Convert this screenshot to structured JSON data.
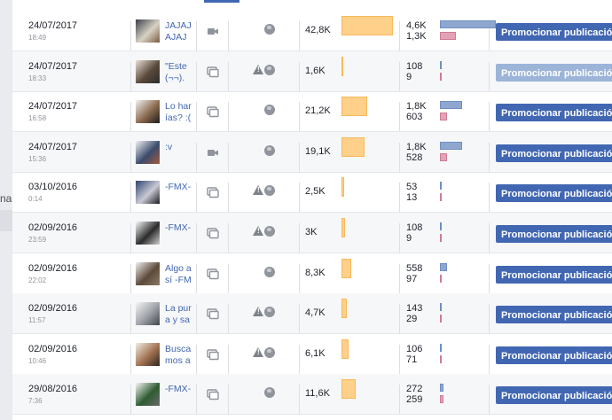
{
  "sidebar": {
    "text": "na"
  },
  "promo_label": "Promocionar publicación",
  "rows": [
    {
      "date": "24/07/2017",
      "time": "18:49",
      "title": "JAJAJAJAJ",
      "type": "video",
      "warn": false,
      "reach": "42,8K",
      "reach_frac": 1.0,
      "eng1": "4,6K",
      "eng2": "1,3K",
      "eng1_frac": 1.0,
      "eng2_frac": 0.28,
      "promo_disabled": false
    },
    {
      "date": "24/07/2017",
      "time": "18:33",
      "title": "\"Este (¬¬).",
      "type": "share",
      "warn": true,
      "reach": "1,6K",
      "reach_frac": 0.03,
      "eng1": "108",
      "eng2": "9",
      "eng1_frac": 0.02,
      "eng2_frac": 0.01,
      "promo_disabled": true
    },
    {
      "date": "24/07/2017",
      "time": "16:58",
      "title": "Lo harías? :(",
      "type": "share",
      "warn": false,
      "reach": "21,2K",
      "reach_frac": 0.5,
      "eng1": "1,8K",
      "eng2": "603",
      "eng1_frac": 0.39,
      "eng2_frac": 0.13,
      "promo_disabled": false
    },
    {
      "date": "24/07/2017",
      "time": "15:36",
      "title": ":v",
      "type": "video",
      "warn": false,
      "reach": "19,1K",
      "reach_frac": 0.45,
      "eng1": "1,8K",
      "eng2": "528",
      "eng1_frac": 0.39,
      "eng2_frac": 0.12,
      "promo_disabled": false
    },
    {
      "date": "03/10/2016",
      "time": "0:14",
      "title": "-FMX-",
      "type": "share",
      "warn": true,
      "reach": "2,5K",
      "reach_frac": 0.06,
      "eng1": "53",
      "eng2": "13",
      "eng1_frac": 0.01,
      "eng2_frac": 0.01,
      "promo_disabled": false
    },
    {
      "date": "02/09/2016",
      "time": "23:59",
      "title": "-FMX-",
      "type": "share",
      "warn": true,
      "reach": "3K",
      "reach_frac": 0.07,
      "eng1": "108",
      "eng2": "9",
      "eng1_frac": 0.02,
      "eng2_frac": 0.01,
      "promo_disabled": false
    },
    {
      "date": "02/09/2016",
      "time": "22:02",
      "title": "Algo así -FM",
      "type": "share",
      "warn": false,
      "reach": "8,3K",
      "reach_frac": 0.19,
      "eng1": "558",
      "eng2": "97",
      "eng1_frac": 0.12,
      "eng2_frac": 0.02,
      "promo_disabled": false
    },
    {
      "date": "02/09/2016",
      "time": "11:57",
      "title": "La pura y sa",
      "type": "share",
      "warn": true,
      "reach": "4,7K",
      "reach_frac": 0.11,
      "eng1": "143",
      "eng2": "29",
      "eng1_frac": 0.03,
      "eng2_frac": 0.01,
      "promo_disabled": false
    },
    {
      "date": "02/09/2016",
      "time": "10:46",
      "title": "Buscamos a",
      "type": "share",
      "warn": true,
      "reach": "6,1K",
      "reach_frac": 0.14,
      "eng1": "106",
      "eng2": "71",
      "eng1_frac": 0.02,
      "eng2_frac": 0.02,
      "promo_disabled": false
    },
    {
      "date": "29/08/2016",
      "time": "7:36",
      "title": "-FMX-",
      "type": "share",
      "warn": false,
      "reach": "11,6K",
      "reach_frac": 0.27,
      "eng1": "272",
      "eng2": "259",
      "eng1_frac": 0.06,
      "eng2_frac": 0.06,
      "promo_disabled": false
    }
  ]
}
